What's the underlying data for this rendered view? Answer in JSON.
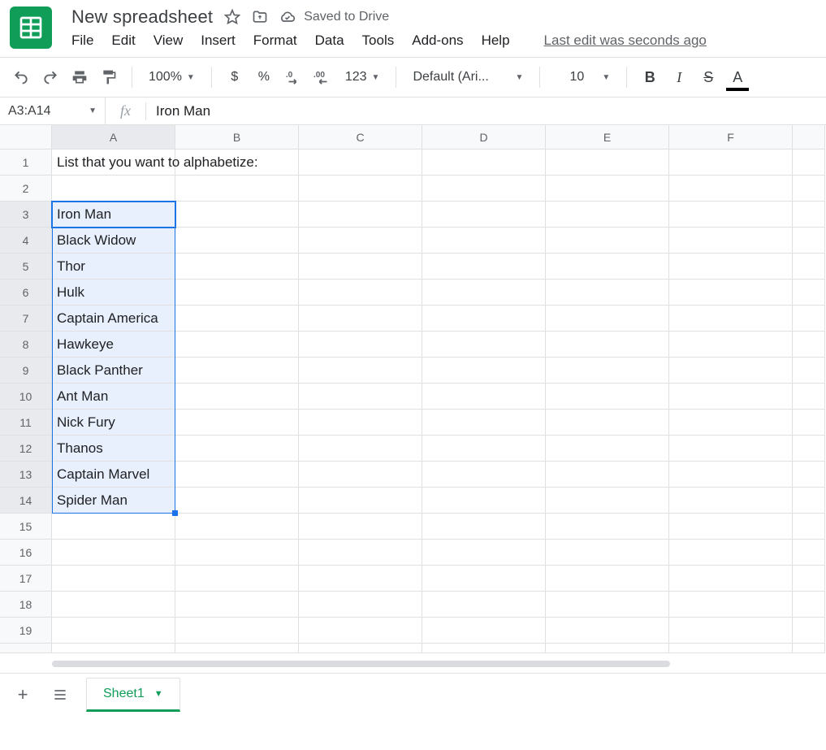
{
  "doc": {
    "title": "New spreadsheet",
    "saved_label": "Saved to Drive",
    "last_edit": "Last edit was seconds ago"
  },
  "menu": [
    "File",
    "Edit",
    "View",
    "Insert",
    "Format",
    "Data",
    "Tools",
    "Add-ons",
    "Help"
  ],
  "toolbar": {
    "zoom": "100%",
    "font": "Default (Ari...",
    "font_size": "10",
    "currency_symbol": "$",
    "percent_symbol": "%",
    "number_format_label": "123"
  },
  "name_box": "A3:A14",
  "formula_value": "Iron Man",
  "columns": [
    "A",
    "B",
    "C",
    "D",
    "E",
    "F"
  ],
  "row_count": 19,
  "selection": {
    "col": 0,
    "row_start": 3,
    "row_end": 14
  },
  "cells": {
    "A1": "List that you want to alphabetize:",
    "A3": "Iron Man",
    "A4": "Black Widow",
    "A5": "Thor",
    "A6": "Hulk",
    "A7": "Captain America",
    "A8": "Hawkeye",
    "A9": "Black Panther",
    "A10": "Ant Man",
    "A11": "Nick Fury",
    "A12": "Thanos",
    "A13": "Captain Marvel",
    "A14": "Spider Man"
  },
  "sheets": {
    "active": "Sheet1"
  }
}
